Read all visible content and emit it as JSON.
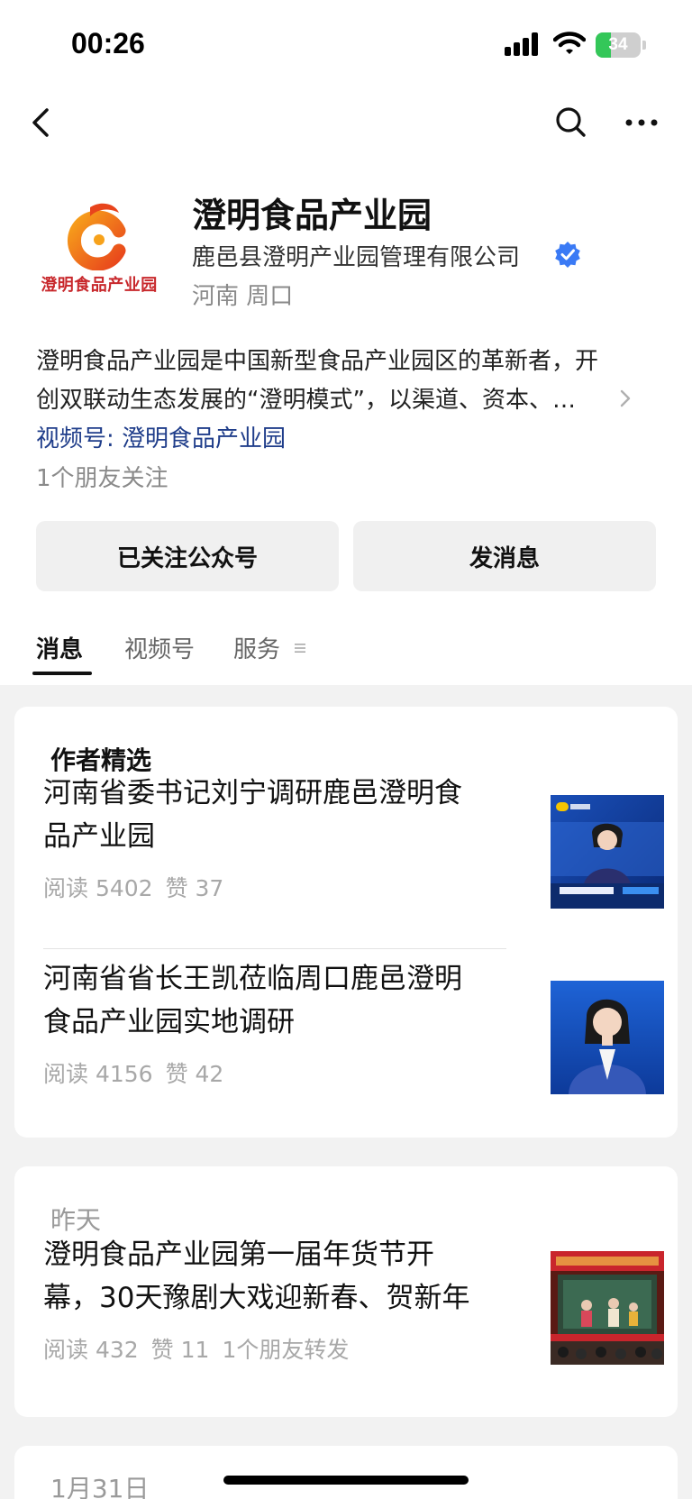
{
  "status_bar": {
    "time": "00:26",
    "battery_level": "34",
    "battery_fraction": 0.34,
    "battery_color": "#34c759"
  },
  "nav": {
    "back_icon": "chevron-left-icon",
    "search_icon": "search-icon",
    "more_icon": "more-dots-icon"
  },
  "profile": {
    "logo_text": "澄明食品产业园",
    "name": "澄明食品产业园",
    "company": "鹿邑县澄明产业园管理有限公司",
    "verified_icon": "verified-badge-icon",
    "verified_color": "#3a7af5",
    "location": "河南 周口",
    "description_line1": "澄明食品产业园是中国新型食品产业园区的革新者，开",
    "description_line2": "创双联动生态发展的“澄明模式”，以渠道、资本、…",
    "channel_link": "视频号: 澄明食品产业园",
    "friends_follow": "1个朋友关注"
  },
  "actions": {
    "followed_label": "已关注公众号",
    "message_label": "发消息"
  },
  "tabs": {
    "messages": "消息",
    "channels": "视频号",
    "services": "服务"
  },
  "feed": {
    "featured": {
      "heading": "作者精选",
      "articles": [
        {
          "title_line1": "河南省委书记刘宁调研鹿邑澄明食",
          "title_line2": "品产业园",
          "reads": "阅读 5402",
          "likes": "赞 37"
        },
        {
          "title_line1": "河南省省长王凯莅临周口鹿邑澄明",
          "title_line2": "食品产业园实地调研",
          "reads": "阅读 4156",
          "likes": "赞 42"
        }
      ]
    },
    "yesterday": {
      "heading": "昨天",
      "articles": [
        {
          "title_line1": "澄明食品产业园第一届年货节开",
          "title_line2": "幕，30天豫剧大戏迎新春、贺新年",
          "reads": "阅读 432",
          "likes": "赞 11",
          "shares": "1个朋友转发"
        }
      ]
    },
    "next_heading": "1月31日"
  }
}
